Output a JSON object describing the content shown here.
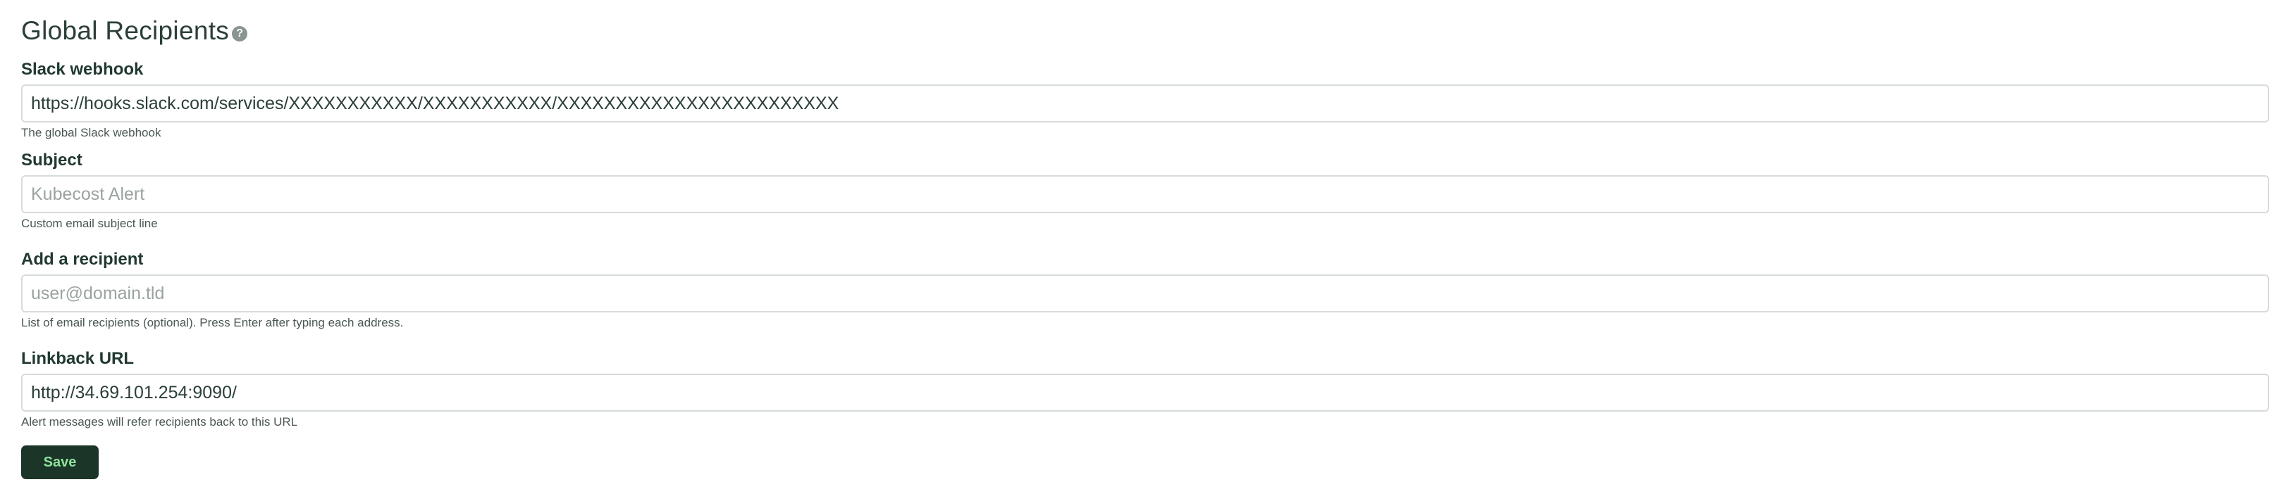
{
  "header": {
    "title": "Global Recipients",
    "help_icon_glyph": "?"
  },
  "fields": {
    "slack": {
      "label": "Slack webhook",
      "value": "https://hooks.slack.com/services/XXXXXXXXXXX/XXXXXXXXXXX/XXXXXXXXXXXXXXXXXXXXXXXX",
      "placeholder": "",
      "help": "The global Slack webhook"
    },
    "subject": {
      "label": "Subject",
      "value": "",
      "placeholder": "Kubecost Alert",
      "help": "Custom email subject line"
    },
    "recipient": {
      "label": "Add a recipient",
      "value": "",
      "placeholder": "user@domain.tld",
      "help": "List of email recipients (optional). Press Enter after typing each address."
    },
    "linkback": {
      "label": "Linkback URL",
      "value": "http://34.69.101.254:9090/",
      "placeholder": "",
      "help": "Alert messages will refer recipients back to this URL"
    }
  },
  "actions": {
    "save_label": "Save"
  },
  "colors": {
    "save_bg": "#1b3529",
    "save_text": "#8ee39a",
    "input_border": "#d6dcd9"
  }
}
